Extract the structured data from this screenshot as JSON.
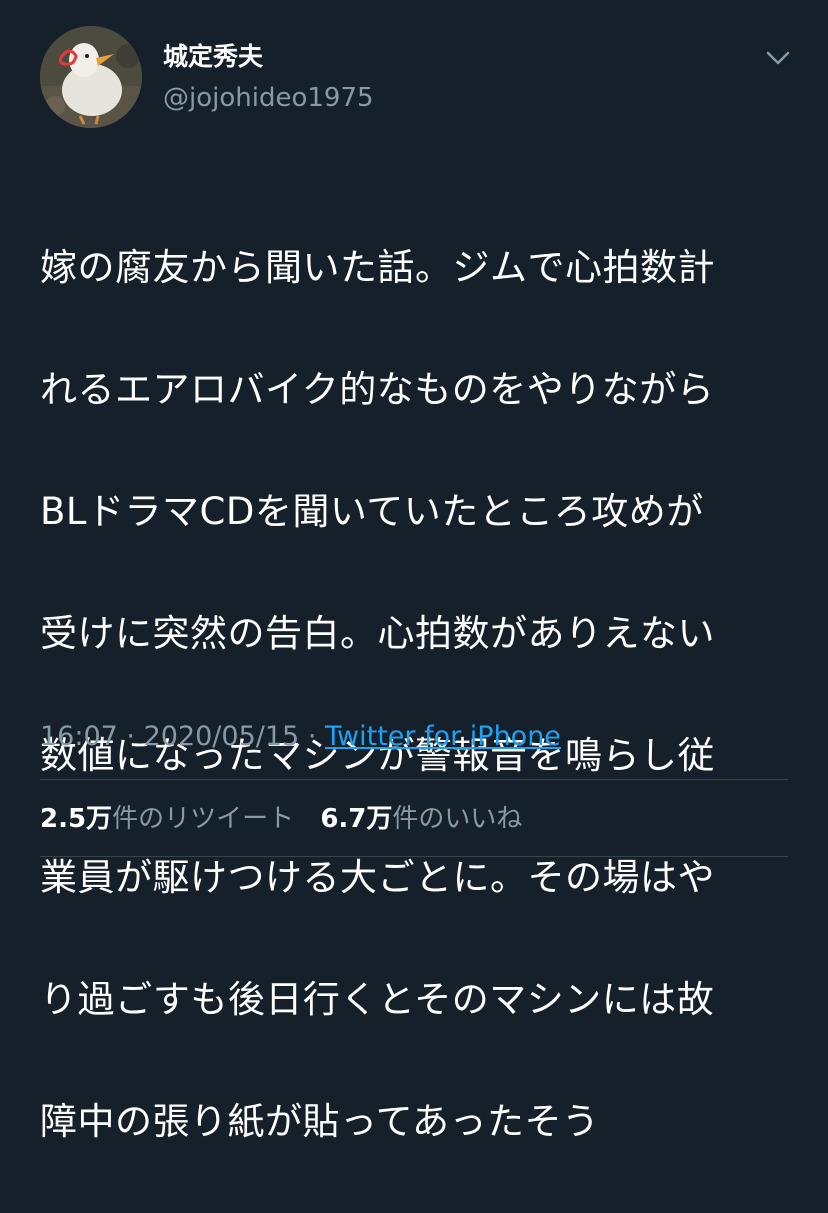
{
  "tweet": {
    "author": {
      "display_name": "城定秀夫",
      "handle": "@jojohideo1975"
    },
    "text_lines": [
      "嫁の腐友から聞いた話。ジムで心拍数計",
      "れるエアロバイク的なものをやりながら",
      "BLドラマCDを聞いていたところ攻めが",
      "受けに突然の告白。心拍数がありえない",
      "数値になったマシンが警報音を鳴らし従",
      "業員が駆けつける大ごとに。その場はや",
      "り過ごすも後日行くとそのマシンには故",
      "障中の張り紙が貼ってあったそう"
    ],
    "time": "16:07",
    "date": "2020/05/15",
    "separator": "·",
    "source": "Twitter for iPhone",
    "stats": {
      "retweets_num": "2.5万",
      "retweets_label": "件のリツイート",
      "likes_num": "6.7万",
      "likes_label": "件のいいね"
    },
    "icons": {
      "caret": "chevron-down-icon",
      "avatar": "avatar-duck-image"
    },
    "colors": {
      "background": "#15202b",
      "secondary_text": "#8899a6",
      "link": "#1da1f2",
      "divider": "#38444d"
    }
  }
}
